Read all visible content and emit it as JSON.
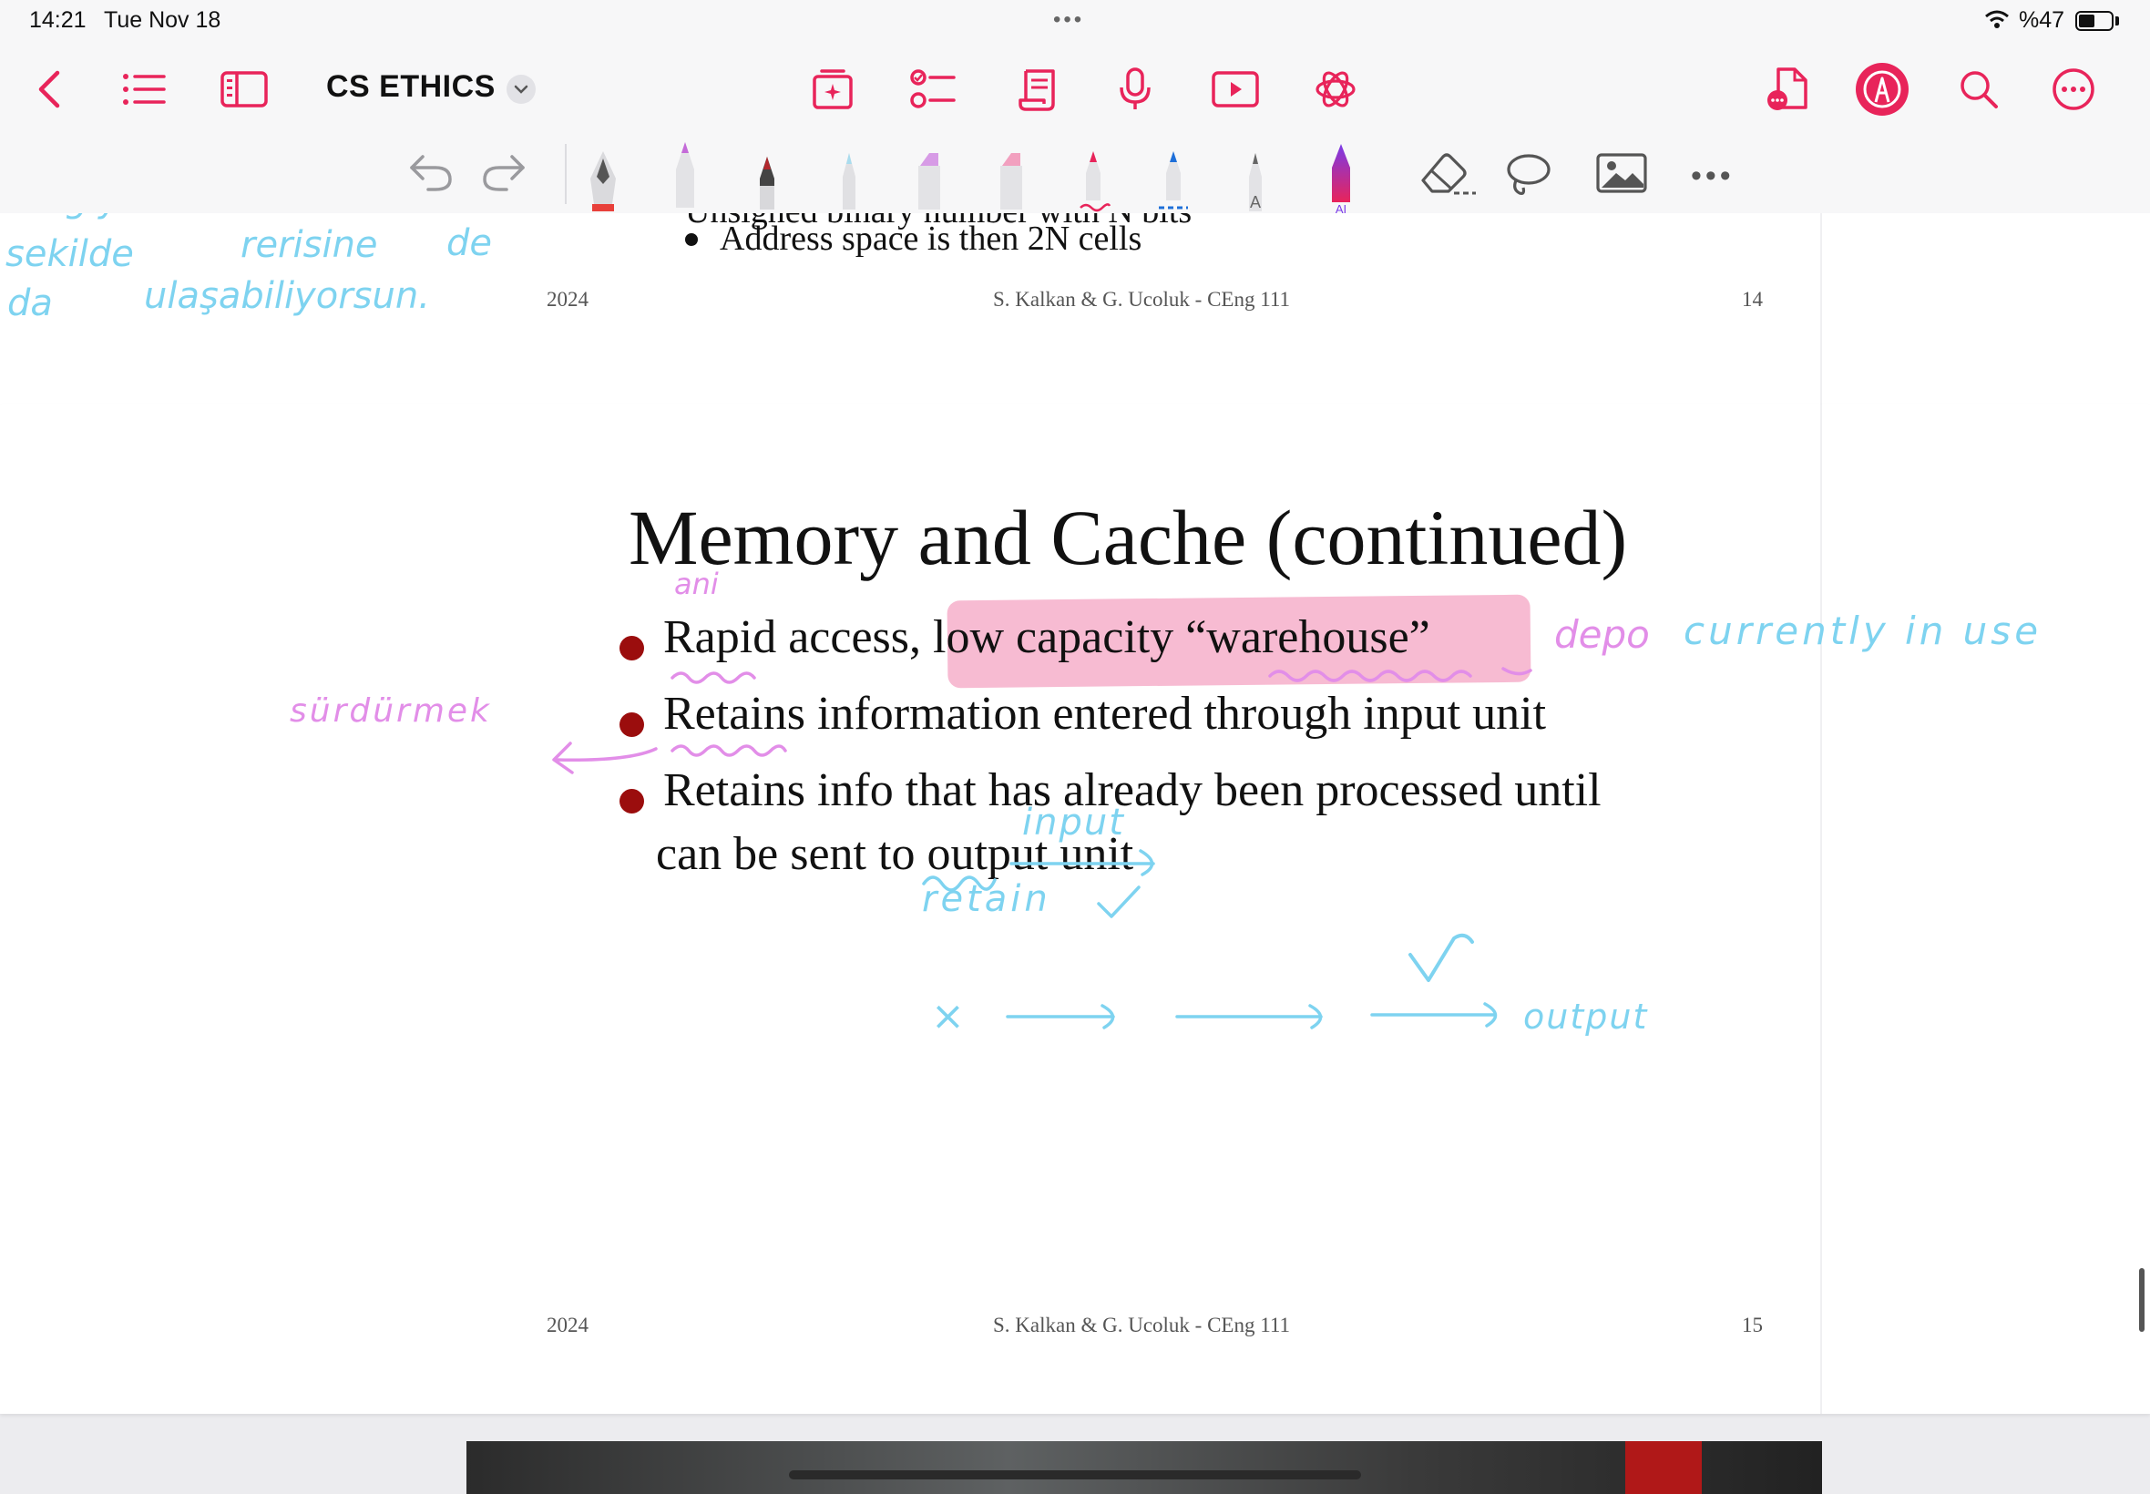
{
  "status": {
    "time": "14:21",
    "date": "Tue Nov 18",
    "battery": "%47",
    "battery_level": 0.47
  },
  "nav": {
    "title": "CS ETHICS"
  },
  "colors": {
    "accent": "#e8245a",
    "bullet": "#9b0d0d",
    "highlight": "#f296ba",
    "ink_blue": "#7ed3f0",
    "ink_pink": "#e28ee8"
  },
  "page14": {
    "partial_bullet": "Unsigned binary number with N bits",
    "bullet": "Address space is then 2N cells",
    "footer_year": "2024",
    "footer_authors": "S. Kalkan & G. Ucoluk  - CEng 111",
    "footer_page": "14",
    "notes": {
      "line1": "bilgiyi similar o",
      "line2_a": "sekilde",
      "line2_b": "rerisine",
      "line2_c": "de",
      "line3_a": "da",
      "line3_b": "ulaşabiliyorsun."
    }
  },
  "page15": {
    "title": "Memory and Cache (continued)",
    "bullets": {
      "b1_plain": "Rapid access,",
      "b1_highlight": "low capacity “warehouse”",
      "b2": "Retains information entered through input unit",
      "b3_line1": "Retains info that has already been processed until",
      "b3_line2": "can be sent to output unit"
    },
    "footer_year": "2024",
    "footer_authors": "S. Kalkan & G. Ucoluk  - CEng 111",
    "footer_page": "15",
    "notes": {
      "ani": "ani",
      "depo": "depo",
      "currently": "currently in use",
      "surdurmek": "sürdürmek",
      "input": "input",
      "retain": "retain",
      "x": "×",
      "output": "output"
    }
  }
}
